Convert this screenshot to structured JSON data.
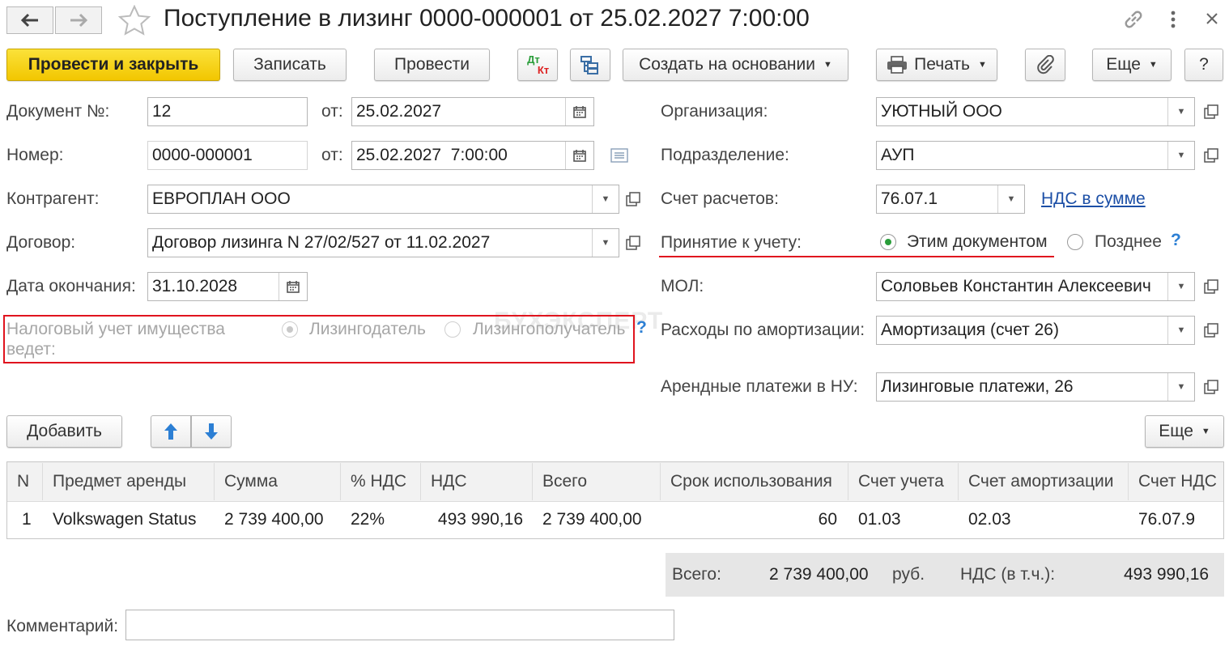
{
  "window": {
    "title": "Поступление в лизинг 0000-000001 от 25.02.2027 7:00:00"
  },
  "toolbar": {
    "post_close": "Провести и закрыть",
    "save": "Записать",
    "post": "Провести",
    "dtkt_top": "Дт",
    "dtkt_bottom": "Кт",
    "create_based": "Создать на основании",
    "print": "Печать",
    "more": "Еще",
    "help": "?"
  },
  "form": {
    "doc_no_label": "Документ №:",
    "doc_no_value": "12",
    "from_label": "от:",
    "doc_date": "25.02.2027",
    "number_label": "Номер:",
    "number_value": "0000-000001",
    "number_date": "25.02.2027  7:00:00",
    "counterparty_label": "Контрагент:",
    "counterparty_value": "ЕВРОПЛАН ООО",
    "contract_label": "Договор:",
    "contract_value": "Договор лизинга N 27/02/527 от 11.02.2027",
    "end_date_label": "Дата окончания:",
    "end_date_value": "31.10.2028",
    "tax_label": "Налоговый учет имущества ведет:",
    "tax_opt1": "Лизингодатель",
    "tax_opt2": "Лизингополучатель",
    "tax_help": "?",
    "org_label": "Организация:",
    "org_value": "УЮТНЫЙ ООО",
    "division_label": "Подразделение:",
    "division_value": "АУП",
    "account_label": "Счет расчетов:",
    "account_value": "76.07.1",
    "vat_link": "НДС в сумме",
    "acceptance_label": "Принятие к учету:",
    "acceptance_opt1": "Этим документом",
    "acceptance_opt2": "Позднее",
    "acceptance_help": "?",
    "mol_label": "МОЛ:",
    "mol_value": "Соловьев Константин Алексеевич",
    "amort_label": "Расходы по амортизации:",
    "amort_value": "Амортизация (счет 26)",
    "rent_label": "Арендные платежи в НУ:",
    "rent_value": "Лизинговые платежи, 26"
  },
  "table_toolbar": {
    "add": "Добавить",
    "more": "Еще"
  },
  "table": {
    "headers": [
      "N",
      "Предмет аренды",
      "Сумма",
      "% НДС",
      "НДС",
      "Всего",
      "Срок использования",
      "Счет учета",
      "Счет амортизации",
      "Счет НДС"
    ],
    "rows": [
      [
        "1",
        "Volkswagen Status",
        "2 739 400,00",
        "22%",
        "493 990,16",
        "2 739 400,00",
        "60",
        "01.03",
        "02.03",
        "76.07.9"
      ]
    ]
  },
  "totals": {
    "total_label": "Всего:",
    "total_value": "2 739 400,00",
    "currency": "руб.",
    "vat_label": "НДС (в т.ч.):",
    "vat_value": "493 990,16"
  },
  "comment": {
    "label": "Комментарий:",
    "value": ""
  },
  "watermark": "БУХЭКСПЕРТ",
  "colors": {
    "primary_button": "#f5cc00",
    "highlight_red": "#e0141e",
    "link": "#1c4fa6",
    "radio_on": "#2a9d3a",
    "arrow_blue": "#2c7fd4"
  }
}
